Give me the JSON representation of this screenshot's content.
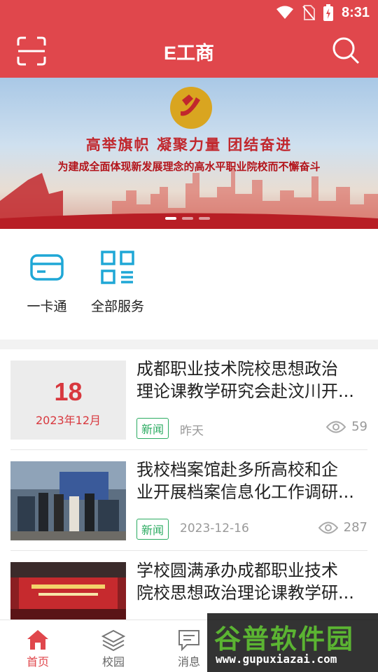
{
  "status_bar": {
    "time": "8:31"
  },
  "header": {
    "title": "E工商"
  },
  "banner": {
    "headline": "高举旗帜  凝聚力量  团结奋进",
    "subline": "为建成全面体现新发展理念的高水平职业院校而不懈奋斗",
    "page_count": 3,
    "active_page": 1
  },
  "services": [
    {
      "label": "一卡通",
      "icon": "card-icon"
    },
    {
      "label": "全部服务",
      "icon": "grid-menu-icon"
    }
  ],
  "news": [
    {
      "title_line1": "成都职业技术院校思想政治",
      "title_line2": "理论课教学研究会赴汶川开...",
      "date_day": "18",
      "date_month": "2023年12月",
      "tag": "新闻",
      "date": "昨天",
      "views": "59"
    },
    {
      "title_line1": "我校档案馆赴多所高校和企",
      "title_line2": "业开展档案信息化工作调研...",
      "tag": "新闻",
      "date": "2023-12-16",
      "views": "287"
    },
    {
      "title_line1": "学校圆满承办成都职业技术",
      "title_line2": "院校思想政治理论课教学研..."
    }
  ],
  "bottom_nav": [
    {
      "label": "首页",
      "icon": "home-icon",
      "active": true
    },
    {
      "label": "校园",
      "icon": "layers-icon",
      "active": false
    },
    {
      "label": "消息",
      "icon": "message-icon",
      "active": false
    }
  ],
  "watermark": {
    "text": "谷普软件园",
    "url": "www.gupuxiazai.com"
  },
  "colors": {
    "primary": "#e0474c",
    "tag_green": "#2bab61",
    "service_blue": "#1fa7d6",
    "date_red": "#d8383e"
  }
}
